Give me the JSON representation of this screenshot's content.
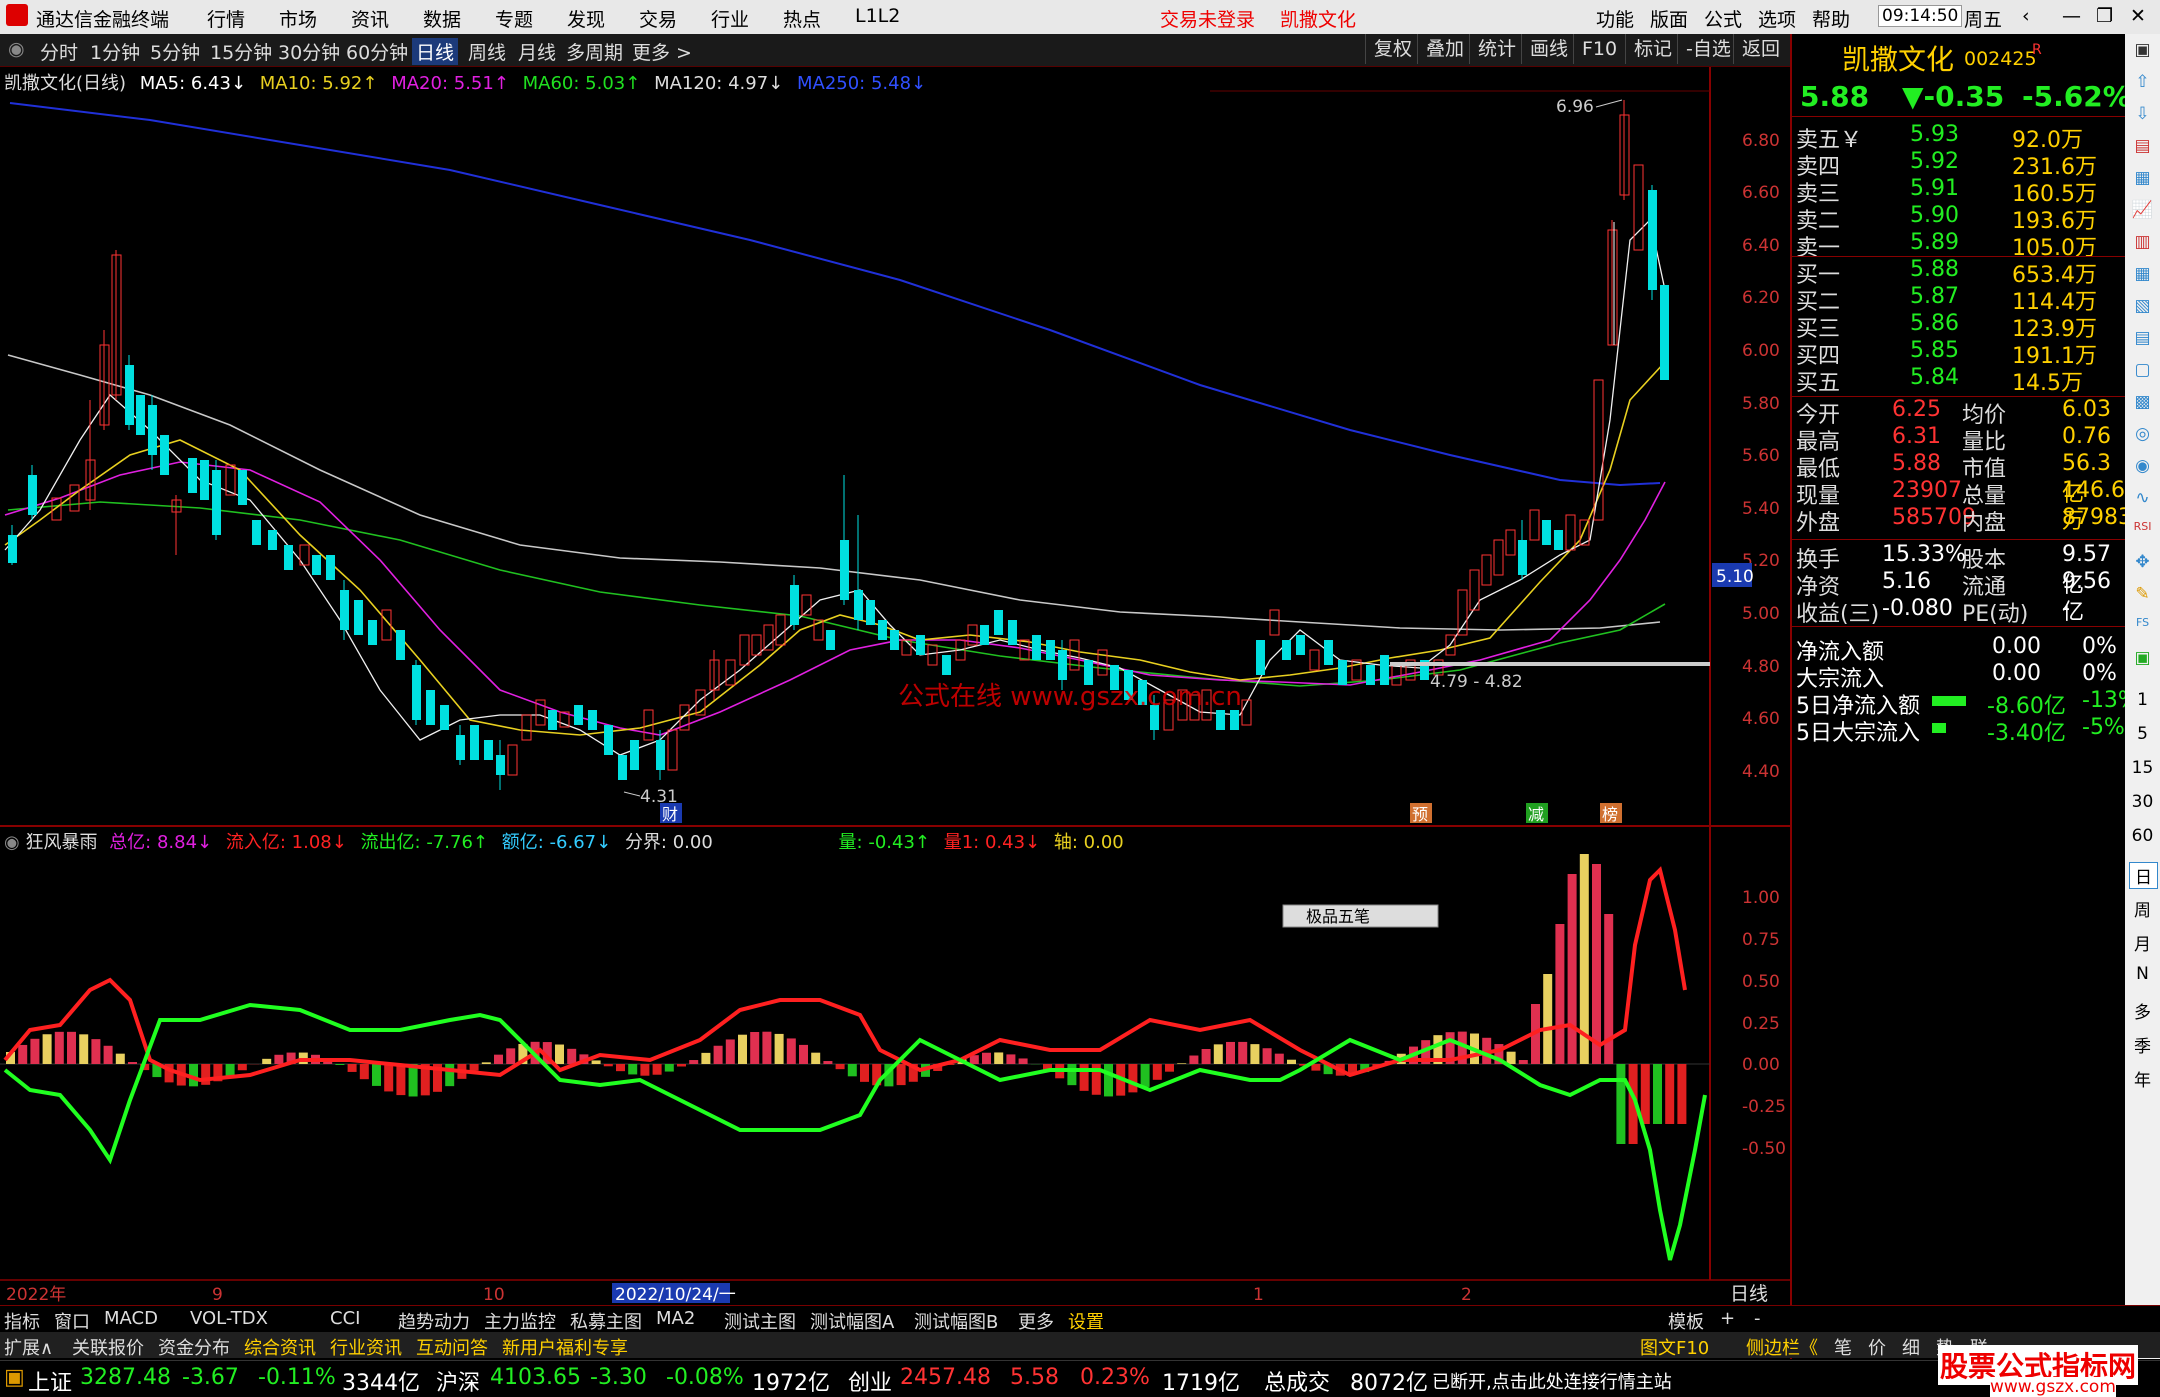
{
  "app": {
    "name": "通达信金融终端",
    "menus": [
      "行情",
      "市场",
      "资讯",
      "数据",
      "专题",
      "发现",
      "交易",
      "行业",
      "热点",
      "L1L2"
    ],
    "notice": "交易未登录",
    "stock": "凯撒文化",
    "right_menus": [
      "功能",
      "版面",
      "公式",
      "选项",
      "帮助"
    ],
    "time": "09:14:50",
    "weekday": "周五"
  },
  "toolbar": {
    "periods": [
      "分时",
      "1分钟",
      "5分钟",
      "15分钟",
      "30分钟",
      "60分钟",
      "日线",
      "周线",
      "月线",
      "多周期",
      "更多 >"
    ],
    "active": "日线",
    "right": [
      "复权",
      "叠加",
      "统计",
      "画线",
      "F10",
      "标记",
      "-自选",
      "返回"
    ]
  },
  "chart_info": {
    "title": "凯撒文化(日线)",
    "ma5": "MA5: 6.43↓",
    "ma10": "MA10: 5.92↑",
    "ma20": "MA20: 5.51↑",
    "ma60": "MA60: 5.03↑",
    "ma120": "MA120: 4.97↓",
    "ma250": "MA250: 5.48↓"
  },
  "price_axis": [
    "6.80",
    "6.60",
    "6.40",
    "6.20",
    "6.00",
    "5.80",
    "5.60",
    "5.40",
    "5.20",
    "5.00",
    "4.80",
    "4.60",
    "4.40"
  ],
  "current_price_tag": "5.10",
  "annotations": {
    "high": "6.96",
    "low": "4.31",
    "range": "4.79 - 4.82",
    "cai": "财",
    "yu": "预",
    "jian": "减",
    "bang": "榜",
    "watermark": "公式在线  www.gszx.com.cn"
  },
  "indicator_info": {
    "name": "狂风暴雨",
    "zy": "总亿: 8.84↓",
    "lry": "流入亿: 1.08↓",
    "lcy": "流出亿: -7.76↑",
    "ey": "额亿: -6.67↓",
    "fj": "分界: 0.00",
    "liang": "量: -0.43↑",
    "liang1": "量1: 0.43↓",
    "zhou": "轴: 0.00"
  },
  "ind_axis": [
    "1.00",
    "0.75",
    "0.50",
    "0.25",
    "0.00",
    "-0.25",
    "-0.50"
  ],
  "ime": "极品五笔",
  "date_axis": {
    "y": "2022年",
    "m9": "9",
    "m10": "10",
    "cursor": "2022/10/24/一",
    "m1": "1",
    "m2": "2",
    "period": "日线"
  },
  "tabs1": [
    "指标",
    "窗口",
    "MACD",
    "VOL-TDX",
    "CCI",
    "趋势动力",
    "主力监控",
    "私募主图",
    "MA2",
    "测试主图",
    "测试幅图A",
    "测试幅图B",
    "更多",
    "设置"
  ],
  "tabs1_right": [
    "模板",
    "+",
    "-"
  ],
  "tabs2": [
    "扩展∧",
    "关联报价",
    "资金分布",
    "综合资讯",
    "行业资讯",
    "互动问答",
    "新用户福利专享"
  ],
  "tabs2_right": [
    "图文F10",
    "侧边栏《",
    "笔",
    "价",
    "细",
    "势",
    "联"
  ],
  "quote": {
    "name": "凯撒文化",
    "code": "002425",
    "r": "R",
    "price": "5.88",
    "change": "▼-0.35",
    "pct": "-5.62%",
    "asks": [
      [
        "卖五￥",
        "5.93",
        "92.0万"
      ],
      [
        "卖四",
        "5.92",
        "231.6万"
      ],
      [
        "卖三",
        "5.91",
        "160.5万"
      ],
      [
        "卖二",
        "5.90",
        "193.6万"
      ],
      [
        "卖一",
        "5.89",
        "105.0万"
      ]
    ],
    "bids": [
      [
        "买一",
        "5.88",
        "653.4万"
      ],
      [
        "买二",
        "5.87",
        "114.4万"
      ],
      [
        "买三",
        "5.86",
        "123.9万"
      ],
      [
        "买四",
        "5.85",
        "191.1万"
      ],
      [
        "买五",
        "5.84",
        "14.5万"
      ]
    ],
    "stats": [
      [
        "今开",
        "6.25",
        "均价",
        "6.03"
      ],
      [
        "最高",
        "6.31",
        "量比",
        "0.76"
      ],
      [
        "最低",
        "5.88",
        "市值",
        "56.3亿"
      ],
      [
        "现量",
        "23907",
        "总量",
        "146.6万"
      ],
      [
        "外盘",
        "585709",
        "内盘",
        "879832"
      ]
    ],
    "stats2": [
      [
        "换手",
        "15.33%",
        "股本",
        "9.57亿"
      ],
      [
        "净资",
        "5.16",
        "流通",
        "9.56亿"
      ],
      [
        "收益(三)",
        "-0.080",
        "PE(动)",
        "-"
      ]
    ],
    "flows": [
      [
        "净流入额",
        "0.00",
        "0%"
      ],
      [
        "大宗流入",
        "0.00",
        "0%"
      ],
      [
        "5日净流入额",
        "-8.60亿",
        "-13%"
      ],
      [
        "5日大宗流入",
        "-3.40亿",
        "-5%"
      ]
    ]
  },
  "sidebar": [
    "1",
    "5",
    "15",
    "30",
    "60",
    "日",
    "周",
    "月",
    "N",
    "多",
    "季",
    "年"
  ],
  "status": {
    "sh": "上证",
    "sh_v": "3287.48",
    "sh_c": "-3.67",
    "sh_p": "-0.11%",
    "sh_a": "3344亿",
    "hs": "沪深",
    "hs_v": "4103.65",
    "hs_c": "-3.30",
    "hs_p": "-0.08%",
    "hs_a": "1972亿",
    "cy": "创业",
    "cy_v": "2457.48",
    "cy_c": "5.58",
    "cy_p": "0.23%",
    "cy_a": "1719亿",
    "zcj": "总成交",
    "zcj_v": "8072亿",
    "msg": "已断开,点击此处连接行情主站",
    "brand": "股票公式指标网",
    "site": "www.gszx.com"
  }
}
